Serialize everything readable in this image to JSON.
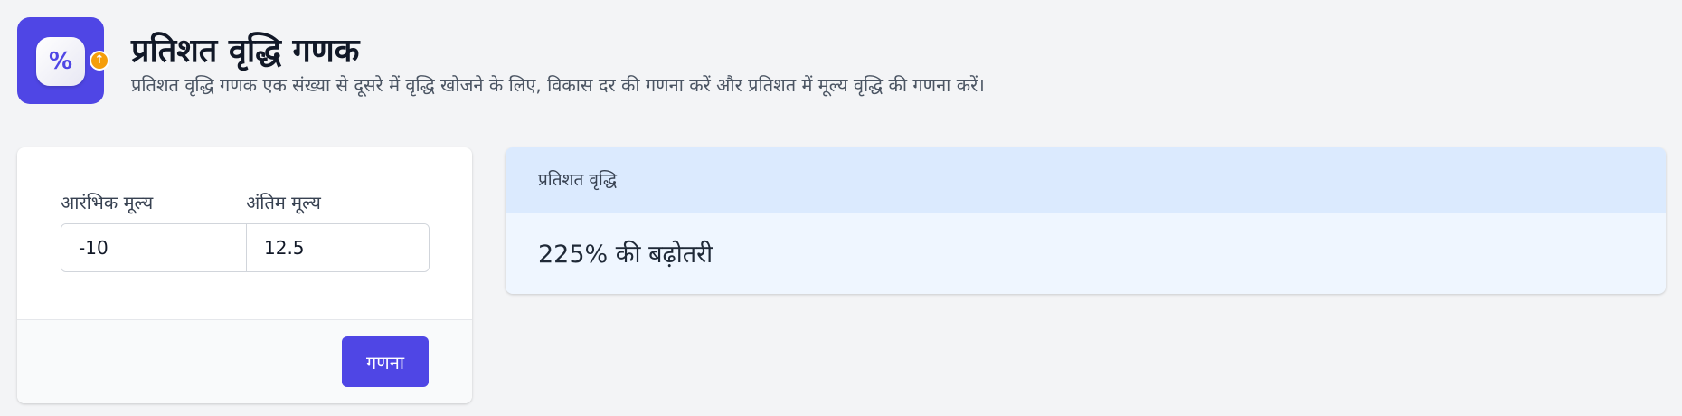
{
  "header": {
    "title": "प्रतिशत वृद्धि गणक",
    "subtitle": "प्रतिशत वृद्धि गणक एक संख्या से दूसरे में वृद्धि खोजने के लिए, विकास दर की गणना करें और प्रतिशत में मूल्य वृद्धि की गणना करें।",
    "icon_symbol": "%",
    "badge_symbol": "↑",
    "icon": "percent-growth-app-icon"
  },
  "form": {
    "initial_label": "आरंभिक मूल्य",
    "final_label": "अंतिम मूल्य",
    "initial_value": "-10",
    "final_value": "12.5",
    "calculate_label": "गणना"
  },
  "result": {
    "heading": "प्रतिशत वृद्धि",
    "text": "225% की बढ़ोतरी"
  },
  "colors": {
    "accent": "#4f46e5",
    "badge": "#f59e0b",
    "result_header": "#dbeafe",
    "result_body": "#eff6ff",
    "background": "#f3f4f6"
  }
}
